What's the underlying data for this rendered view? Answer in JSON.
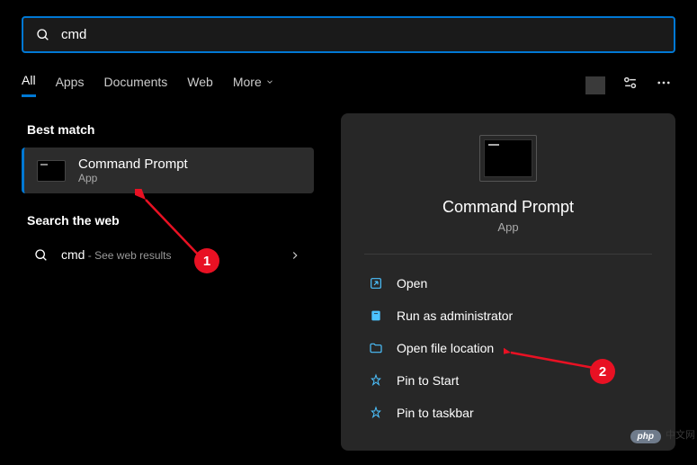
{
  "search": {
    "query": "cmd"
  },
  "tabs": {
    "all": "All",
    "apps": "Apps",
    "documents": "Documents",
    "web": "Web",
    "more": "More"
  },
  "sections": {
    "best_match": "Best match",
    "search_web": "Search the web"
  },
  "result": {
    "title": "Command Prompt",
    "subtitle": "App"
  },
  "web": {
    "term": "cmd",
    "suffix": " - See web results"
  },
  "detail": {
    "title": "Command Prompt",
    "subtitle": "App"
  },
  "actions": {
    "open": "Open",
    "run_admin": "Run as administrator",
    "open_loc": "Open file location",
    "pin_start": "Pin to Start",
    "pin_taskbar": "Pin to taskbar"
  },
  "annotations": {
    "b1": "1",
    "b2": "2"
  },
  "watermark": {
    "php": "php",
    "cn": "中文网"
  }
}
